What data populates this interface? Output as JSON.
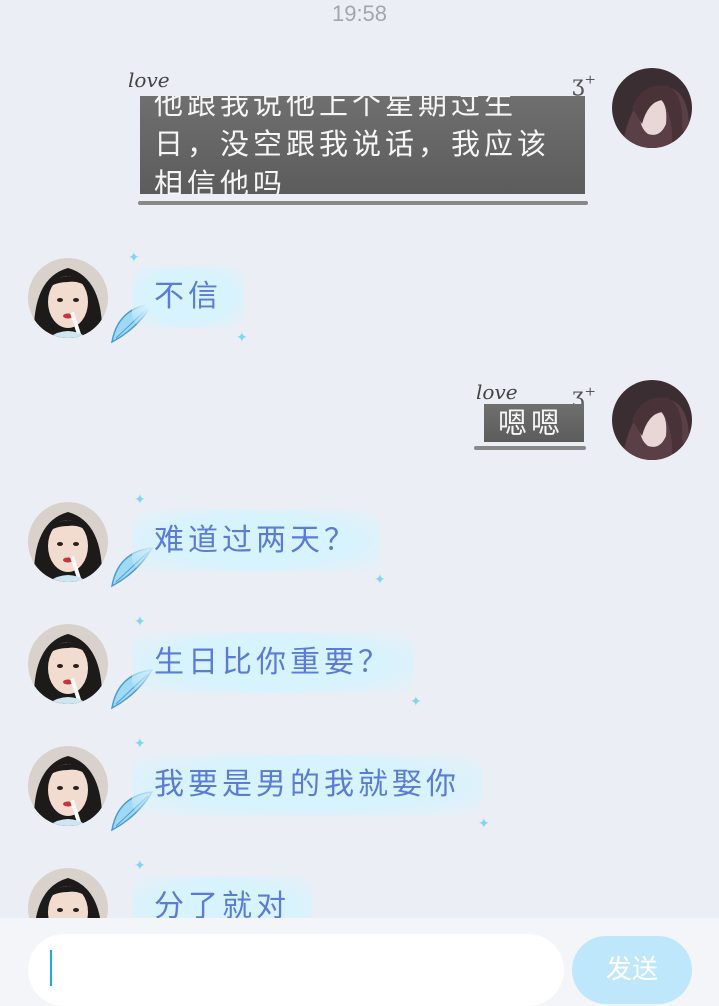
{
  "status_bar": {
    "time": "19:58"
  },
  "messages": [
    {
      "side": "right",
      "lines": [
        "他跟我说他上个星期过生",
        "日，没空跟我说话，我应该",
        "相信他吗"
      ]
    },
    {
      "side": "left",
      "text": "不信"
    },
    {
      "side": "right",
      "lines": [
        "嗯嗯"
      ]
    },
    {
      "side": "left",
      "text": "难道过两天？"
    },
    {
      "side": "left",
      "text": "生日比你重要？"
    },
    {
      "side": "left",
      "text": "我要是男的我就娶你"
    },
    {
      "side": "left",
      "text": "分了就对"
    }
  ],
  "decorations": {
    "love_text": "love"
  },
  "composer": {
    "input_value": "",
    "send_label": "发送"
  },
  "colors": {
    "background": "#ebeef5",
    "left_bubble": "#d7f3fd",
    "left_text": "#5a7bd8",
    "right_bubble": "#666666",
    "send_button": "#bfe7fb",
    "cursor": "#21a4ee"
  }
}
